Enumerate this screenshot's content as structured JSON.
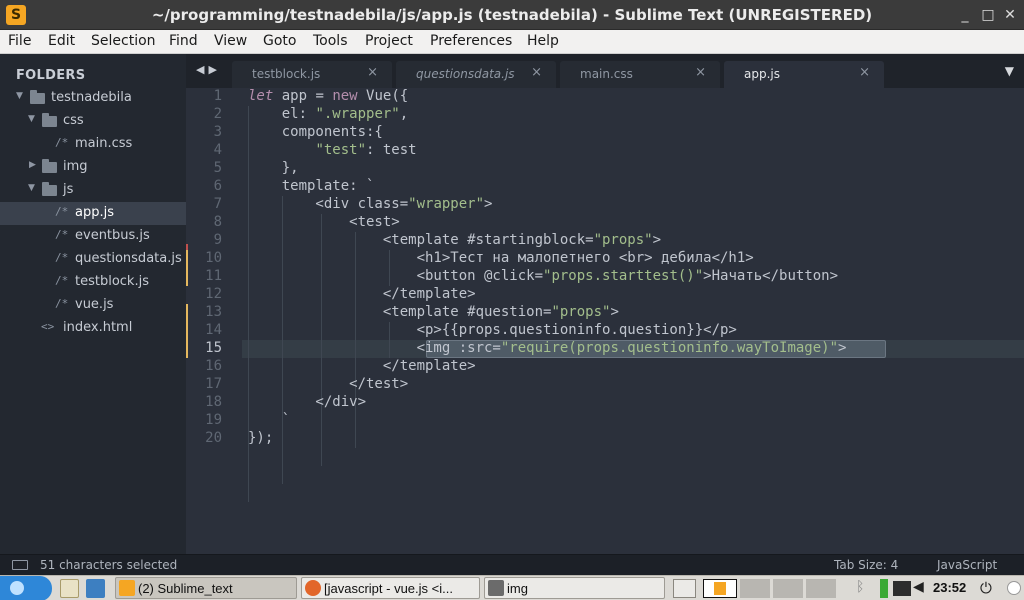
{
  "window": {
    "title": "~/programming/testnadebila/js/app.js (testnadebila) - Sublime Text (UNREGISTERED)",
    "app_icon": "sublime-icon",
    "controls": [
      "minimize-icon",
      "maximize-icon",
      "close-icon"
    ]
  },
  "menu": [
    "File",
    "Edit",
    "Selection",
    "Find",
    "View",
    "Goto",
    "Tools",
    "Project",
    "Preferences",
    "Help"
  ],
  "sidebar": {
    "header": "FOLDERS",
    "tree": [
      {
        "label": "testnadebila",
        "kind": "folder-open"
      },
      {
        "label": "css",
        "kind": "folder-open"
      },
      {
        "label": "main.css",
        "kind": "file"
      },
      {
        "label": "img",
        "kind": "folder-closed"
      },
      {
        "label": "js",
        "kind": "folder-open"
      },
      {
        "label": "app.js",
        "kind": "file",
        "selected": true
      },
      {
        "label": "eventbus.js",
        "kind": "file"
      },
      {
        "label": "questionsdata.js",
        "kind": "file"
      },
      {
        "label": "testblock.js",
        "kind": "file"
      },
      {
        "label": "vue.js",
        "kind": "file"
      },
      {
        "label": "index.html",
        "kind": "html-file"
      }
    ],
    "file_glyph": "/*",
    "html_glyph": "<>"
  },
  "tabs": [
    {
      "label": "testblock.js",
      "italic": false,
      "active": false
    },
    {
      "label": "questionsdata.js",
      "italic": true,
      "active": false
    },
    {
      "label": "main.css",
      "italic": false,
      "active": false
    },
    {
      "label": "app.js",
      "italic": false,
      "active": true
    }
  ],
  "tab_close_glyph": "×",
  "editor": {
    "current_line": 15,
    "lines": [
      "let app = new Vue({",
      "    el: \".wrapper\",",
      "    components:{",
      "        \"test\": test",
      "    },",
      "    template: `",
      "        <div class=\"wrapper\">",
      "            <test>",
      "                <template #startingblock=\"props\">",
      "                    <h1>Тест на малопетнего <br> дебила</h1>",
      "                    <button @click=\"props.starttest()\">Начать</button>",
      "                </template>",
      "                <template #question=\"props\">",
      "                    <p>{{props.questioninfo.question}}</p>",
      "                    <img :src=\"require(props.questioninfo.wayToImage)\">",
      "                </template>",
      "            </test>",
      "        </div>",
      "    `",
      "});"
    ],
    "modified_lines": [
      10,
      11,
      13,
      14,
      15
    ],
    "conflict_lines": [
      9
    ]
  },
  "status": {
    "left": "51 characters selected",
    "tab_size": "Tab Size: 4",
    "syntax": "JavaScript"
  },
  "taskbar": {
    "buttons": [
      {
        "label": "(2) Sublime_text",
        "icon": "sublime-icon",
        "active": true
      },
      {
        "label": "[javascript - vue.js <i...",
        "icon": "firefox-icon",
        "active": false
      },
      {
        "label": "img",
        "icon": "folder-icon",
        "active": false
      }
    ],
    "clock": "23:52"
  }
}
